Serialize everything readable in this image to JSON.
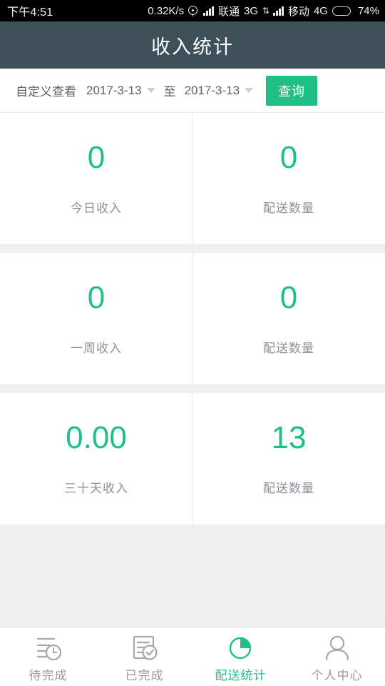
{
  "status_bar": {
    "time": "下午4:51",
    "network_speed": "0.32K/s",
    "gps_icon": "gps-icon",
    "carrier_1": "联通",
    "network_1": "3G",
    "data_transfer_icon": "data-transfer-arrows-icon",
    "carrier_2": "移动",
    "network_2": "4G",
    "battery_icon": "battery-icon",
    "battery_percent": "74%",
    "battery_level": 74
  },
  "header": {
    "title": "收入统计"
  },
  "filter": {
    "label": "自定义查看",
    "start_date": "2017-3-13",
    "separator": "至",
    "end_date": "2017-3-13",
    "query_label": "查询",
    "caret_icon": "chevron-down-icon"
  },
  "stats": [
    {
      "income": {
        "value": "0",
        "label": "今日收入"
      },
      "count": {
        "value": "0",
        "label": "配送数量"
      }
    },
    {
      "income": {
        "value": "0",
        "label": "一周收入"
      },
      "count": {
        "value": "0",
        "label": "配送数量"
      }
    },
    {
      "income": {
        "value": "0.00",
        "label": "三十天收入"
      },
      "count": {
        "value": "13",
        "label": "配送数量"
      }
    }
  ],
  "tabs": [
    {
      "label": "待完成",
      "icon": "list-clock-icon",
      "active": false
    },
    {
      "label": "已完成",
      "icon": "document-check-icon",
      "active": false
    },
    {
      "label": "配送统计",
      "icon": "pie-chart-icon",
      "active": true
    },
    {
      "label": "个人中心",
      "icon": "person-icon",
      "active": false
    }
  ],
  "colors": {
    "accent_green": "#1fbf86",
    "header_bg": "#3d4f58",
    "page_bg": "#efefef",
    "label_gray": "#8b9097",
    "inactive_tab": "#9a9a9a"
  }
}
